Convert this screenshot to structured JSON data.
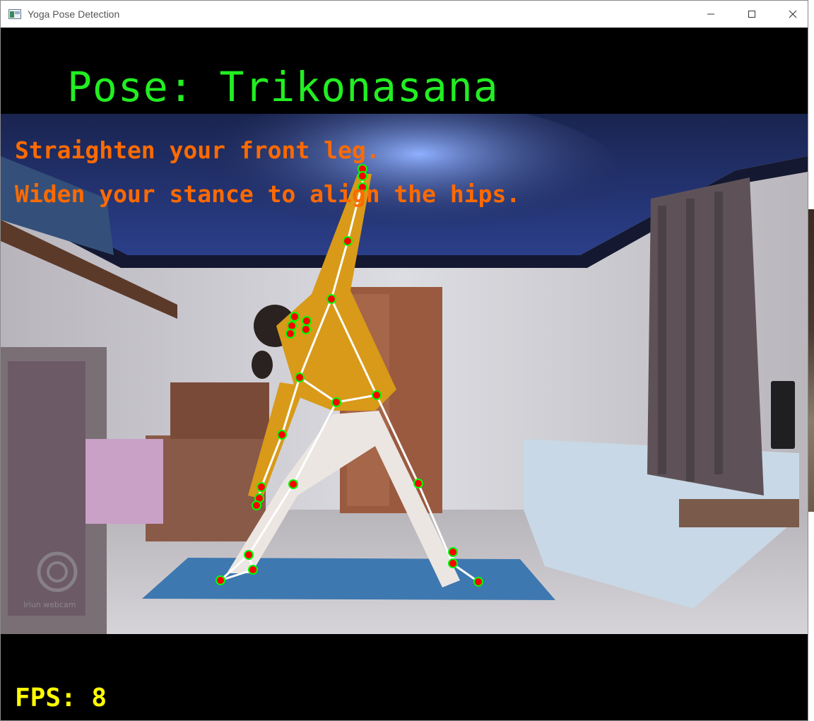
{
  "window": {
    "title": "Yoga Pose Detection",
    "controls": [
      "minimize",
      "maximize",
      "close"
    ]
  },
  "overlay": {
    "pose_label": "Pose: Trikonasana",
    "feedback": [
      "Straighten your front leg.",
      "Widen your stance to align the hips."
    ],
    "fps": "FPS: 8",
    "watermark": "Iriun webcam"
  },
  "colors": {
    "pose_label": "#22ee22",
    "feedback": "#ff6a00",
    "fps": "#ffff00",
    "landmark_fill": "#ff0000",
    "landmark_ring": "#00ff00",
    "skeleton_line": "#ffffff",
    "letterbox": "#000000"
  }
}
